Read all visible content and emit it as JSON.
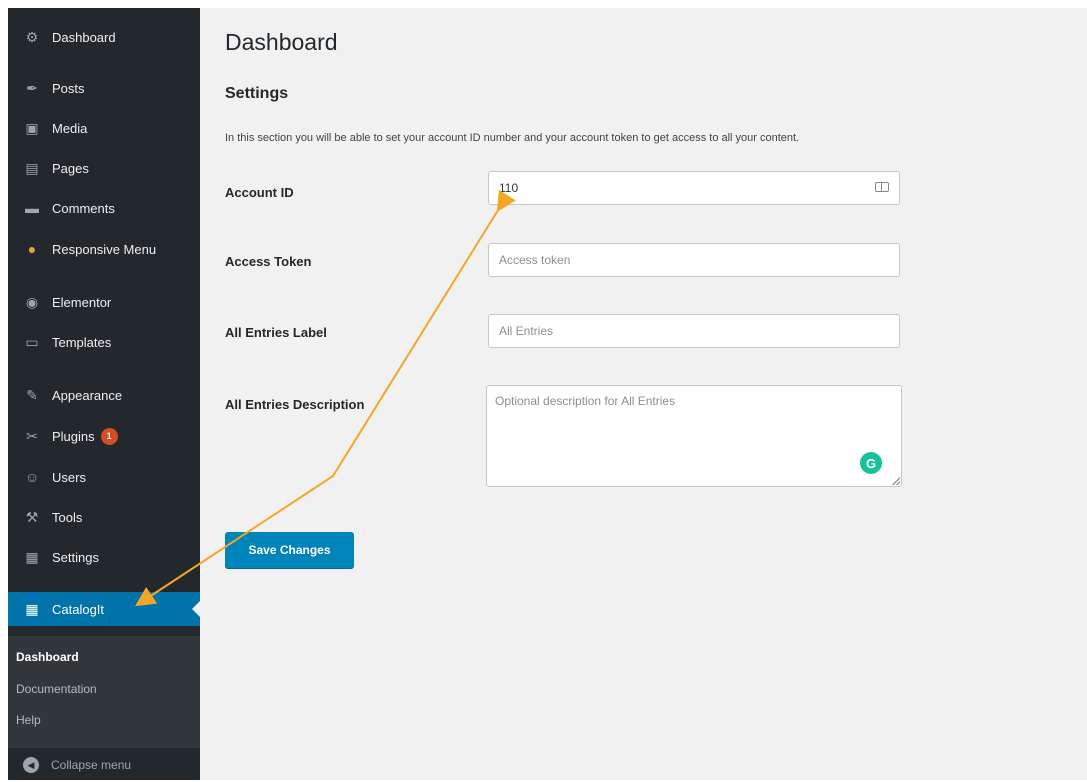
{
  "sidebar": {
    "items": [
      {
        "label": "Dashboard",
        "icon": "dashboard-icon",
        "glyph": "⚙"
      },
      {
        "label": "Posts",
        "icon": "pin-icon",
        "glyph": "✒"
      },
      {
        "label": "Media",
        "icon": "media-icon",
        "glyph": "▣"
      },
      {
        "label": "Pages",
        "icon": "pages-icon",
        "glyph": "▤"
      },
      {
        "label": "Comments",
        "icon": "comment-icon",
        "glyph": "▬"
      },
      {
        "label": "Responsive Menu",
        "icon": "responsive-menu-icon",
        "glyph": "●"
      },
      {
        "label": "Elementor",
        "icon": "elementor-icon",
        "glyph": "◉"
      },
      {
        "label": "Templates",
        "icon": "folder-icon",
        "glyph": "▭"
      },
      {
        "label": "Appearance",
        "icon": "brush-icon",
        "glyph": "✎"
      },
      {
        "label": "Plugins",
        "icon": "plug-icon",
        "glyph": "✂",
        "badge": "1"
      },
      {
        "label": "Users",
        "icon": "user-icon",
        "glyph": "☺"
      },
      {
        "label": "Tools",
        "icon": "wrench-icon",
        "glyph": "⚒"
      },
      {
        "label": "Settings",
        "icon": "settings-icon",
        "glyph": "▦"
      },
      {
        "label": "CatalogIt",
        "icon": "grid-icon",
        "glyph": "▦"
      }
    ],
    "submenu": [
      "Dashboard",
      "Documentation",
      "Help"
    ],
    "collapse_label": "Collapse menu",
    "collapse_glyph": "◀"
  },
  "main": {
    "title": "Dashboard",
    "section_title": "Settings",
    "description": "In this section you will be able to set your account ID number and your account token to get access to all your content.",
    "fields": {
      "account_id_label": "Account ID",
      "account_id_value": "110",
      "access_token_label": "Access Token",
      "access_token_placeholder": "Access token",
      "entries_label_label": "All Entries Label",
      "entries_label_placeholder": "All Entries",
      "entries_desc_label": "All Entries Description",
      "entries_desc_placeholder": "Optional description for All Entries"
    },
    "grammarly_glyph": "G",
    "save_label": "Save Changes"
  },
  "colors": {
    "sidebar_bg": "#23282d",
    "active_bg": "#0073aa",
    "button_bg": "#0085ba",
    "annotation": "#f5a623"
  }
}
